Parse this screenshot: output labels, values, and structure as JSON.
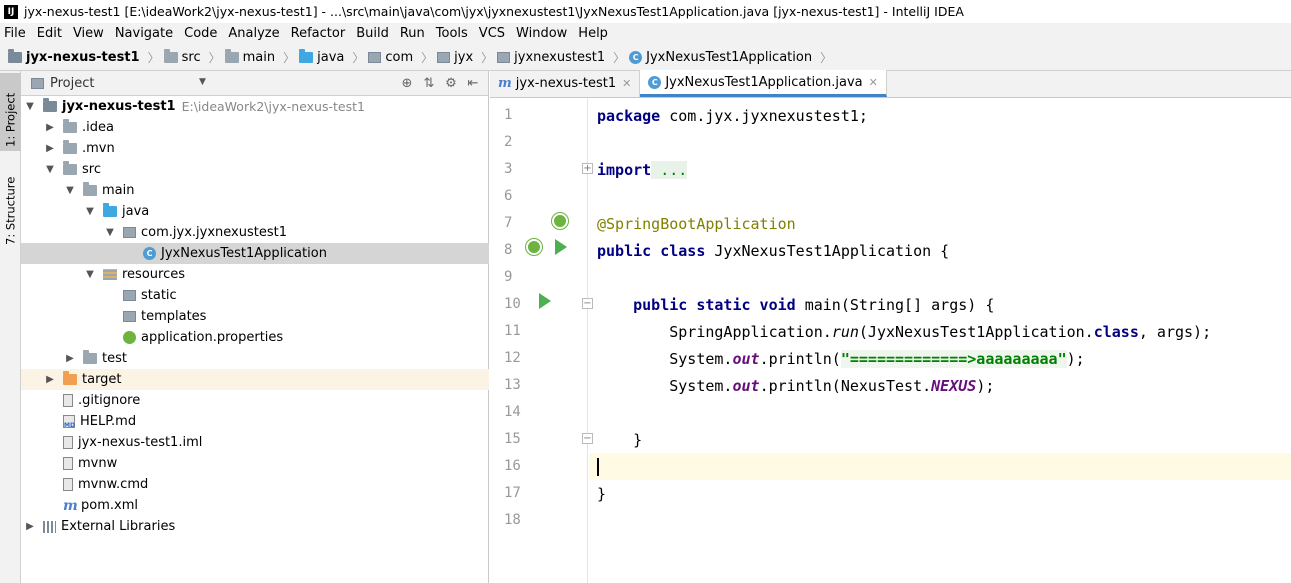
{
  "window": {
    "title": "jyx-nexus-test1 [E:\\ideaWork2\\jyx-nexus-test1] - ...\\src\\main\\java\\com\\jyx\\jyxnexustest1\\JyxNexusTest1Application.java [jyx-nexus-test1] - IntelliJ IDEA",
    "app_icon": "IJ"
  },
  "menu": [
    "File",
    "Edit",
    "View",
    "Navigate",
    "Code",
    "Analyze",
    "Refactor",
    "Build",
    "Run",
    "Tools",
    "VCS",
    "Window",
    "Help"
  ],
  "breadcrumbs": [
    "jyx-nexus-test1",
    "src",
    "main",
    "java",
    "com",
    "jyx",
    "jyxnexustest1",
    "JyxNexusTest1Application"
  ],
  "left_strip": {
    "project_tab": "1: Project",
    "structure_tab": "7: Structure"
  },
  "project_panel": {
    "header": "Project",
    "tree": [
      {
        "label": "jyx-nexus-test1",
        "path": "E:\\ideaWork2\\jyx-nexus-test1",
        "icon": "module-folder-icon",
        "arrow": "expanded"
      },
      {
        "label": ".idea",
        "icon": "folder-icon",
        "arrow": "collapsed"
      },
      {
        "label": ".mvn",
        "icon": "folder-icon",
        "arrow": "collapsed"
      },
      {
        "label": "src",
        "icon": "folder-icon",
        "arrow": "expanded"
      },
      {
        "label": "main",
        "icon": "folder-icon",
        "arrow": "expanded"
      },
      {
        "label": "java",
        "icon": "source-folder-icon",
        "arrow": "expanded"
      },
      {
        "label": "com.jyx.jyxnexustest1",
        "icon": "package-icon",
        "arrow": "expanded"
      },
      {
        "label": "JyxNexusTest1Application",
        "icon": "spring-class-icon",
        "arrow": "none"
      },
      {
        "label": "resources",
        "icon": "resources-folder-icon",
        "arrow": "expanded"
      },
      {
        "label": "static",
        "icon": "package-icon",
        "arrow": "none"
      },
      {
        "label": "templates",
        "icon": "package-icon",
        "arrow": "none"
      },
      {
        "label": "application.properties",
        "icon": "spring-properties-icon",
        "arrow": "none"
      },
      {
        "label": "test",
        "icon": "folder-icon",
        "arrow": "collapsed"
      },
      {
        "label": "target",
        "icon": "excluded-folder-icon",
        "arrow": "collapsed"
      },
      {
        "label": ".gitignore",
        "icon": "text-file-icon",
        "arrow": "none"
      },
      {
        "label": "HELP.md",
        "icon": "markdown-file-icon",
        "arrow": "none"
      },
      {
        "label": "jyx-nexus-test1.iml",
        "icon": "iml-file-icon",
        "arrow": "none"
      },
      {
        "label": "mvnw",
        "icon": "text-file-icon",
        "arrow": "none"
      },
      {
        "label": "mvnw.cmd",
        "icon": "text-file-icon",
        "arrow": "none"
      },
      {
        "label": "pom.xml",
        "icon": "maven-icon",
        "arrow": "none"
      },
      {
        "label": "External Libraries",
        "icon": "library-icon",
        "arrow": "collapsed"
      }
    ]
  },
  "editor": {
    "tabs": [
      {
        "label": "jyx-nexus-test1",
        "icon": "maven-icon",
        "active": false
      },
      {
        "label": "JyxNexusTest1Application.java",
        "icon": "spring-class-icon",
        "active": true
      }
    ],
    "line_numbers": [
      "1",
      "2",
      "3",
      "6",
      "7",
      "8",
      "9",
      "10",
      "11",
      "12",
      "13",
      "14",
      "15",
      "16",
      "17",
      "18"
    ],
    "code": {
      "l1_kw": "package",
      "l1_rest": " com.jyx.jyxnexustest1;",
      "l3_kw": "import",
      "l3_fold": " ...",
      "l7_ann": "@SpringBootApplication",
      "l8_kw": "public class",
      "l8_rest": " JyxNexusTest1Application {",
      "l10_indent": "    ",
      "l10_kw": "public static void",
      "l10_rest": " main(String[] args) {",
      "l11_a": "        SpringApplication.",
      "l11_run": "run",
      "l11_b": "(JyxNexusTest1Application.",
      "l11_class": "class",
      "l11_c": ", args);",
      "l12_a": "        System.",
      "l12_out": "out",
      "l12_b": ".println(",
      "l12_str": "\"=============>aaaaaaaaa\"",
      "l12_c": ");",
      "l13_a": "        System.",
      "l13_out": "out",
      "l13_b": ".println(NexusTest.",
      "l13_const": "NEXUS",
      "l13_c": ");",
      "l15": "    }",
      "l17": "}"
    }
  }
}
